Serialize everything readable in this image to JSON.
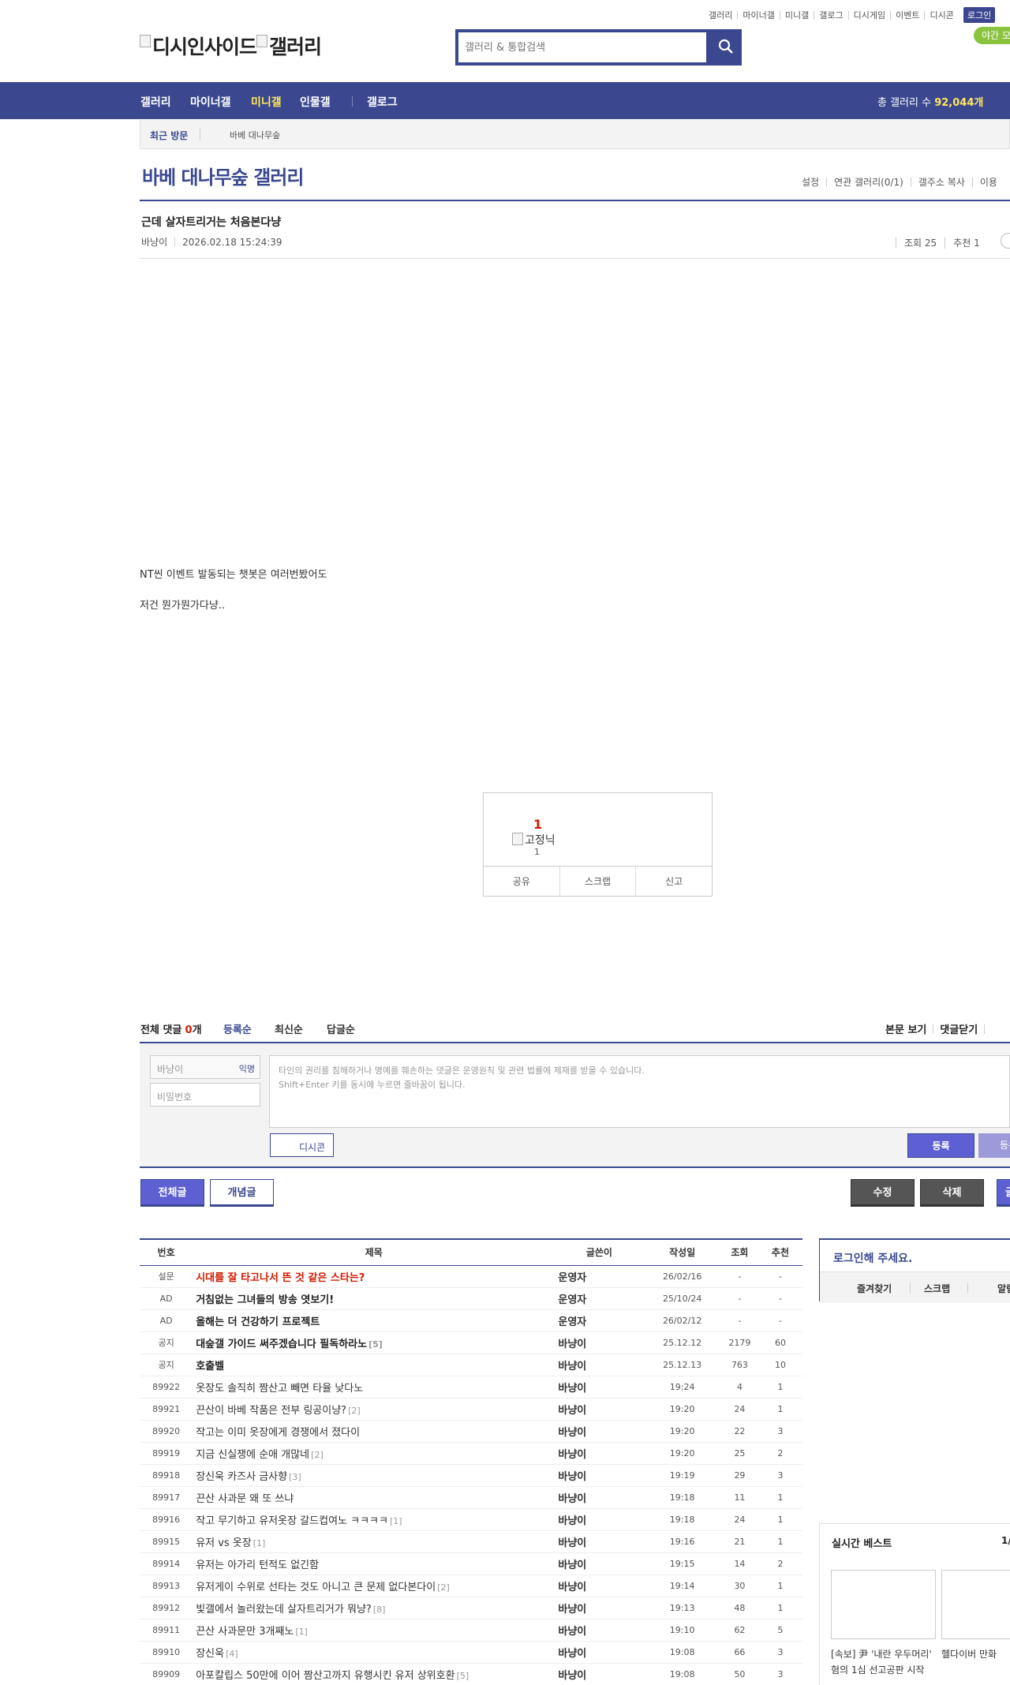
{
  "toplinks": [
    "갤러리",
    "마이너갤",
    "미니갤",
    "갤로그",
    "디시게임",
    "이벤트",
    "디시콘"
  ],
  "login_label": "로그인",
  "night_label": "야간 모",
  "logo_alt_1": "디시인사이드",
  "logo_alt_2": "갤러리",
  "search_placeholder": "갤러리 & 통합검색",
  "nav": {
    "items": [
      "갤러리",
      "마이너갤",
      "미니갤",
      "인물갤",
      "갤로그"
    ],
    "count_label": "총 갤러리 수",
    "count_value": "92,044개"
  },
  "recent": {
    "label": "최근 방문",
    "item": "바베 대나무숲"
  },
  "gallery": {
    "title": "바베 대나무숲 갤러리",
    "links": [
      "설정",
      "연관 갤러리(0/1)",
      "갤주소 복사",
      "이용"
    ]
  },
  "post": {
    "title": "근데 살자트리거는 처음본다냥",
    "author": "바냥이",
    "date": "2026.02.18 15:24:39",
    "views": "조회 25",
    "recommends": "추천 1",
    "body": [
      "NT씬 이벤트 발동되는 챗봇은 여러번봤어도",
      "저건 뭔가뭔가다냥.."
    ]
  },
  "recommend_box": {
    "count": "1",
    "fixnick_alt": "고정닉",
    "fixnick_count": "1",
    "buttons": [
      "공유",
      "스크랩",
      "신고"
    ]
  },
  "comments": {
    "total_label": "전체 댓글",
    "count": "0",
    "unit": "개",
    "sorts": [
      "등록순",
      "최신순",
      "답글순"
    ],
    "right_links": [
      "본문 보기",
      "댓글닫기"
    ],
    "nick_placeholder": "바냥이",
    "anon_label": "익명",
    "pw_placeholder": "비밀번호",
    "textarea_lines": [
      "타인의 권리를 침해하거나 명예를 훼손하는 댓글은 운영원칙 및 관련 법률에 제재를 받을 수 있습니다.",
      "Shift+Enter 키를 동시에 누르면 줄바꿈이 됩니다."
    ],
    "dccon_label": "디시콘",
    "submit_label": "등록",
    "submit2_label": "등록"
  },
  "list_buttons": {
    "all": "전체글",
    "concept": "개념글",
    "edit": "수정",
    "delete": "삭제",
    "write": "글"
  },
  "table": {
    "headers": [
      "번호",
      "제목",
      "글쓴이",
      "작성일",
      "조회",
      "추천"
    ],
    "rows": [
      {
        "no": "설문",
        "title": "시대를 잘 타고나서 뜬 것 같은 스타는?",
        "title_after": "",
        "style": "red",
        "reply": "",
        "writer": "운영자",
        "date": "26/02/16",
        "views": "-",
        "rec": "-"
      },
      {
        "no": "AD",
        "title": "거침없는 그녀들의 방송 엿보기!",
        "title_after": "",
        "style": "bold",
        "reply": "",
        "writer": "운영자",
        "date": "25/10/24",
        "views": "-",
        "rec": "-"
      },
      {
        "no": "AD",
        "title": "올해는 더 건강하기 프로젝트",
        "title_after": "",
        "style": "bold",
        "reply": "",
        "writer": "운영자",
        "date": "26/02/12",
        "views": "-",
        "rec": "-"
      },
      {
        "no": "공지",
        "title": "대숲갤 가이드 써주겠습니다 필독하라노",
        "title_after": "",
        "style": "bold",
        "reply": "[5]",
        "writer": "바냥이",
        "date": "25.12.12",
        "views": "2179",
        "rec": "60"
      },
      {
        "no": "공지",
        "title": "호출벨",
        "title_after": "",
        "style": "bold",
        "reply": "",
        "writer": "바냥이",
        "date": "25.12.13",
        "views": "763",
        "rec": "10"
      },
      {
        "no": "89922",
        "title": "옷장도 솔직히 짬산고 빼면 타율 낮다노",
        "title_after": "",
        "style": "",
        "reply": "",
        "writer": "바냥이",
        "date": "19:24",
        "views": "4",
        "rec": "1"
      },
      {
        "no": "89921",
        "title": "끈산이 바베 작품은 전부 링공이냥?",
        "title_after": "",
        "style": "",
        "reply": "[2]",
        "writer": "바냥이",
        "date": "19:20",
        "views": "24",
        "rec": "1"
      },
      {
        "no": "89920",
        "title": "작고는 이미 옷장에게 경쟁에서 졌다이",
        "title_after": "",
        "style": "",
        "reply": "",
        "writer": "바냥이",
        "date": "19:20",
        "views": "22",
        "rec": "3"
      },
      {
        "no": "89919",
        "title": "지금 신실쟁에 순애 개많네",
        "title_after": "",
        "style": "",
        "reply": "[2]",
        "writer": "바냥이",
        "date": "19:20",
        "views": "25",
        "rec": "2"
      },
      {
        "no": "89918",
        "title": "장신욱 카즈사 금사향",
        "title_after": "",
        "style": "",
        "reply": "[3]",
        "writer": "바냥이",
        "date": "19:19",
        "views": "29",
        "rec": "3"
      },
      {
        "no": "89917",
        "title": "끈산 사과문 왜 또 쓰냐",
        "title_after": "",
        "style": "",
        "reply": "",
        "writer": "바냥이",
        "date": "19:18",
        "views": "11",
        "rec": "1"
      },
      {
        "no": "89916",
        "title": "작고 무기하고 유저옷장 갈드컵여노 ㅋㅋㅋㅋ",
        "title_after": "",
        "style": "",
        "reply": "[1]",
        "writer": "바냥이",
        "date": "19:18",
        "views": "24",
        "rec": "1"
      },
      {
        "no": "89915",
        "title": "유저 vs 옷장",
        "title_after": "",
        "style": "",
        "reply": "[1]",
        "writer": "바냥이",
        "date": "19:16",
        "views": "21",
        "rec": "1"
      },
      {
        "no": "89914",
        "title": "유저는 아가리 턴적도 없긴함",
        "title_after": "",
        "style": "",
        "reply": "",
        "writer": "바냥이",
        "date": "19:15",
        "views": "14",
        "rec": "2"
      },
      {
        "no": "89913",
        "title": "유저게이 수위로 선타는 것도 아니고 큰 문제 없다본다이",
        "title_after": "",
        "style": "",
        "reply": "[2]",
        "writer": "바냥이",
        "date": "19:14",
        "views": "30",
        "rec": "1"
      },
      {
        "no": "89912",
        "title": "빛갤에서 놀러왔는데 살자트리거가 뭐냥?",
        "title_after": "",
        "style": "",
        "reply": "[8]",
        "writer": "바냥이",
        "date": "19:13",
        "views": "48",
        "rec": "1"
      },
      {
        "no": "89911",
        "title": "끈산 사과문만 3개째노",
        "title_after": "",
        "style": "",
        "reply": "[1]",
        "writer": "바냥이",
        "date": "19:10",
        "views": "62",
        "rec": "5"
      },
      {
        "no": "89910",
        "title": "장신욱",
        "title_after": "",
        "style": "",
        "reply": "[4]",
        "writer": "바냥이",
        "date": "19:08",
        "views": "66",
        "rec": "3"
      },
      {
        "no": "89909",
        "title": "아포칼립스 50만에 이어 짬산고까지 유행시킨 유저 상위호환",
        "title_after": "",
        "style": "",
        "reply": "[5]",
        "writer": "바냥이",
        "date": "19:08",
        "views": "50",
        "rec": "3"
      }
    ]
  },
  "side_login": {
    "title": "로그인해 주세요.",
    "links": [
      "즐겨찾기",
      "스크랩",
      "알림"
    ]
  },
  "side_best": {
    "title": "실시간 베스트",
    "page": "1/",
    "captions": [
      "[속보] 尹 '내란 우두머리' 혐의 1심 선고공판 시작",
      "헬다이버 만화"
    ]
  },
  "colors": {
    "brand": "#3b4890",
    "accent": "#5e5fd2",
    "nav_highlight": "#ffe75b",
    "red": "#d31900"
  }
}
